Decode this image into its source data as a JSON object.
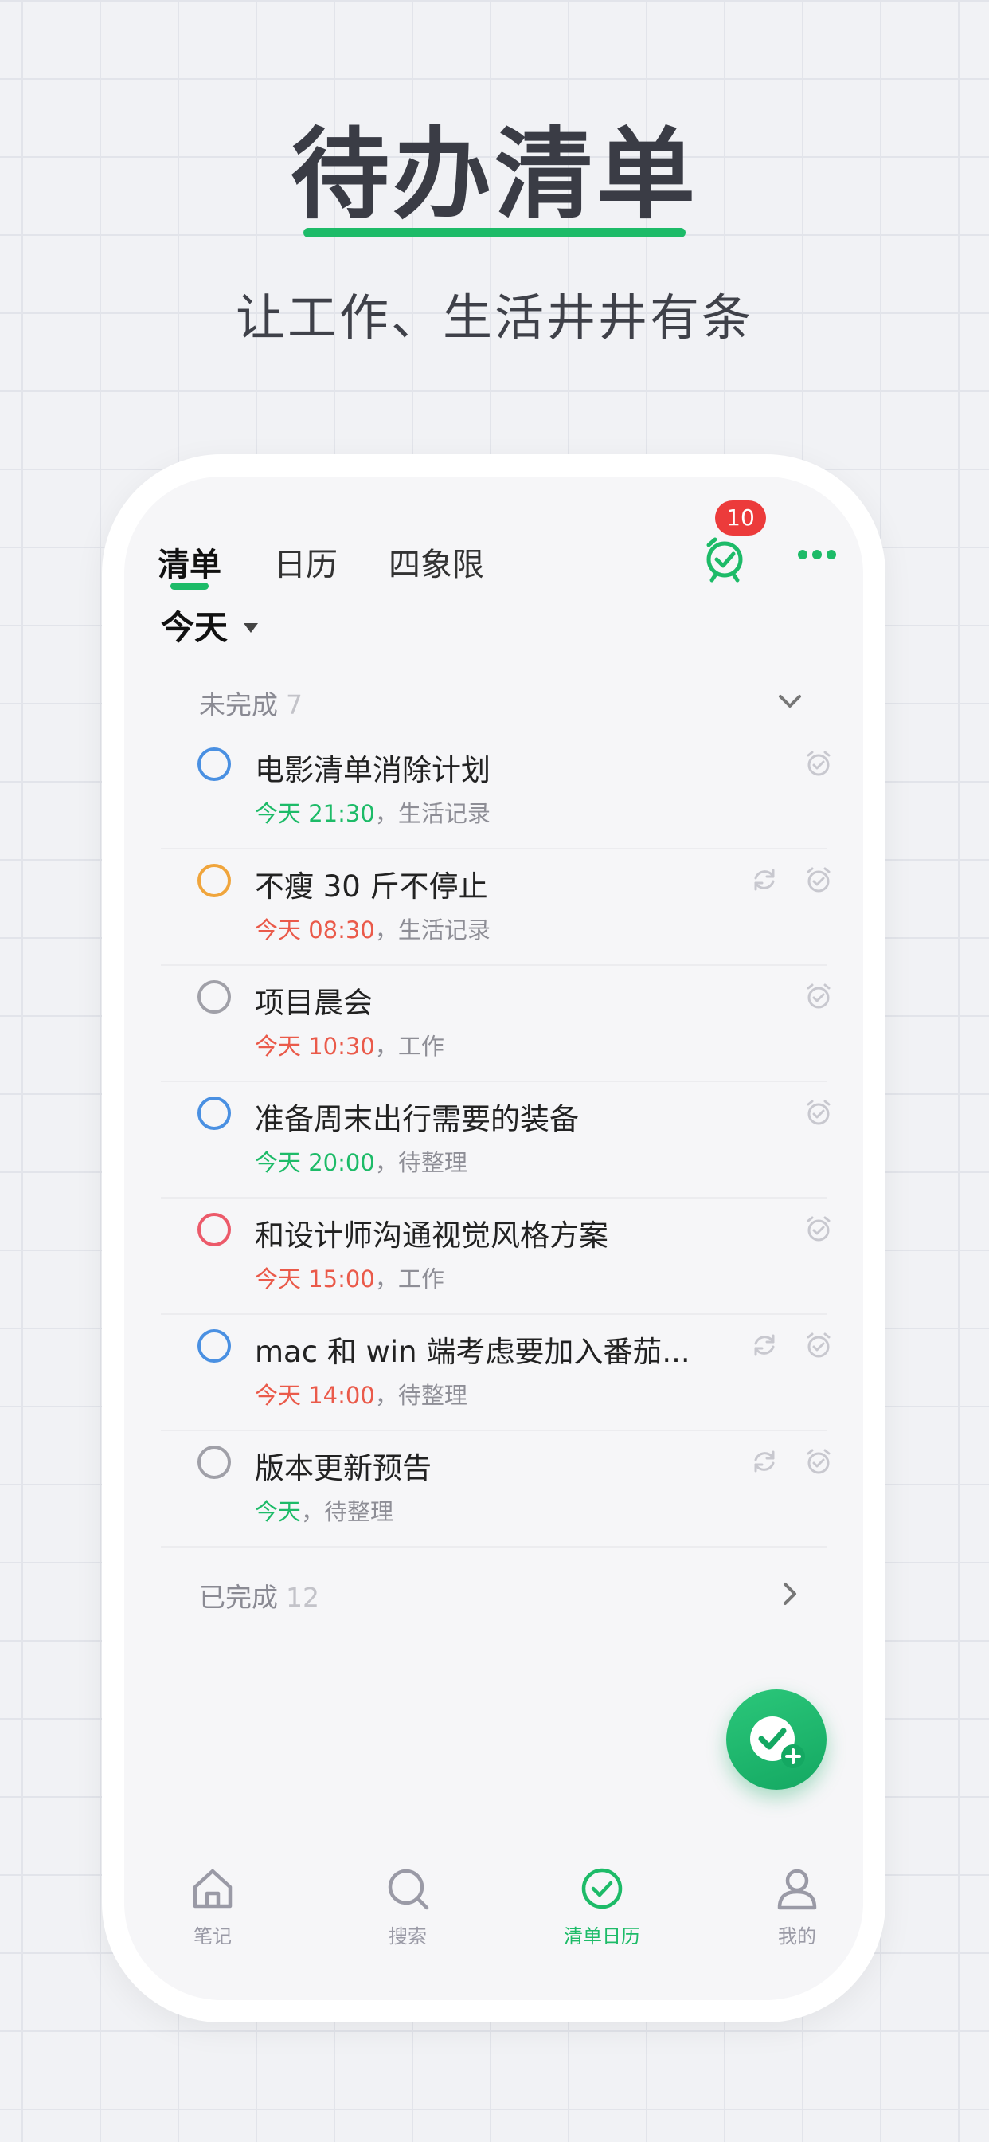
{
  "hero": {
    "title": "待办清单",
    "subtitle": "让工作、生活井井有条"
  },
  "header": {
    "tabs": [
      {
        "label": "清单",
        "active": true
      },
      {
        "label": "日历",
        "active": false
      },
      {
        "label": "四象限",
        "active": false
      }
    ],
    "alarm_badge": "10",
    "icons": {
      "alarm": "alarm-clock-icon",
      "more": "more-dots-icon"
    }
  },
  "date_filter": {
    "label": "今天"
  },
  "incomplete": {
    "label": "未完成",
    "count": "7"
  },
  "tasks": [
    {
      "title": "电影清单消除计划",
      "time": "今天 21:30",
      "sep": "，",
      "list": "生活记录",
      "check_color": "#4a90e2",
      "time_color": "#1dbb68",
      "repeat": false
    },
    {
      "title": "不瘦 30 斤不停止",
      "time": "今天 08:30",
      "sep": "，",
      "list": "生活记录",
      "check_color": "#f0a53c",
      "time_color": "#ea5a4a",
      "repeat": true
    },
    {
      "title": "项目晨会",
      "time": "今天 10:30",
      "sep": "，",
      "list": "工作",
      "check_color": "#a0a0a8",
      "time_color": "#ea5a4a",
      "repeat": false
    },
    {
      "title": "准备周末出行需要的装备",
      "time": "今天 20:00",
      "sep": "，",
      "list": "待整理",
      "check_color": "#4a90e2",
      "time_color": "#1dbb68",
      "repeat": false
    },
    {
      "title": "和设计师沟通视觉风格方案",
      "time": "今天 15:00",
      "sep": "，",
      "list": "工作",
      "check_color": "#ec5a6a",
      "time_color": "#ea5a4a",
      "repeat": false
    },
    {
      "title": "mac 和 win 端考虑要加入番茄...",
      "time": "今天 14:00",
      "sep": "，",
      "list": "待整理",
      "check_color": "#4a90e2",
      "time_color": "#ea5a4a",
      "repeat": true
    },
    {
      "title": "版本更新预告",
      "time": "今天",
      "sep": "，",
      "list": "待整理",
      "check_color": "#a0a0a8",
      "time_color": "#1dbb68",
      "repeat": true
    }
  ],
  "completed": {
    "label": "已完成",
    "count": "12"
  },
  "bottom_nav": [
    {
      "label": "笔记",
      "icon": "home-icon",
      "active": false
    },
    {
      "label": "搜索",
      "icon": "search-icon",
      "active": false
    },
    {
      "label": "清单日历",
      "icon": "check-circle-icon",
      "active": true
    },
    {
      "label": "我的",
      "icon": "user-icon",
      "active": false
    }
  ],
  "colors": {
    "accent": "#1dbb68",
    "badge": "#ec3b3b",
    "overdue": "#ea5a4a"
  }
}
